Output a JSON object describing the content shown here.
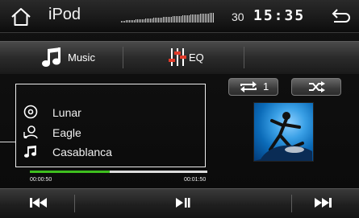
{
  "header": {
    "title": "iPod",
    "volume": "30",
    "clock": "15:35",
    "home_icon": "home-icon",
    "back_icon": "back-arrow-icon"
  },
  "menu": {
    "items": [
      {
        "label": "Music",
        "icon": "music-note-icon"
      },
      {
        "label": "EQ",
        "icon": "equalizer-icon"
      }
    ]
  },
  "playback": {
    "repeat_count": "1",
    "repeat_icon": "repeat-icon",
    "shuffle_icon": "shuffle-icon",
    "elapsed": "00:00:50",
    "total": "00:01:50",
    "progress_fraction": 0.45
  },
  "track": {
    "album": "Lunar",
    "artist": "Eagle",
    "song": "Casablanca"
  },
  "transport": {
    "prev_icon": "previous-track-icon",
    "play_pause_icon": "play-pause-icon",
    "next_icon": "next-track-icon"
  },
  "colors": {
    "progress": "#3fbf1f",
    "background": "#111111"
  }
}
